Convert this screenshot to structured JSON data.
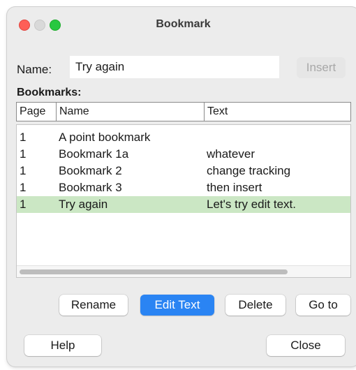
{
  "window": {
    "title": "Bookmark"
  },
  "name_row": {
    "label": "Name:",
    "value": "Try again",
    "insert_label": "Insert"
  },
  "bookmarks": {
    "label": "Bookmarks:",
    "columns": [
      "Page",
      "Name",
      "Text"
    ],
    "rows": [
      {
        "page": "1",
        "name": "A point bookmark",
        "text": ""
      },
      {
        "page": "1",
        "name": "Bookmark 1a",
        "text": "whatever"
      },
      {
        "page": "1",
        "name": "Bookmark 2",
        "text": "change tracking"
      },
      {
        "page": "1",
        "name": "Bookmark 3",
        "text": "then insert"
      },
      {
        "page": "1",
        "name": "Try again",
        "text": "Let's try edit text."
      }
    ],
    "selected_index": 4
  },
  "actions": {
    "rename": "Rename",
    "edit_text": "Edit Text",
    "delete": "Delete",
    "go_to": "Go to"
  },
  "footer": {
    "help": "Help",
    "close": "Close"
  },
  "colors": {
    "selected_row": "#cbe7c4",
    "primary_button": "#2a84f3",
    "close_light": "#fe5f57",
    "maximize_light": "#28c840"
  }
}
